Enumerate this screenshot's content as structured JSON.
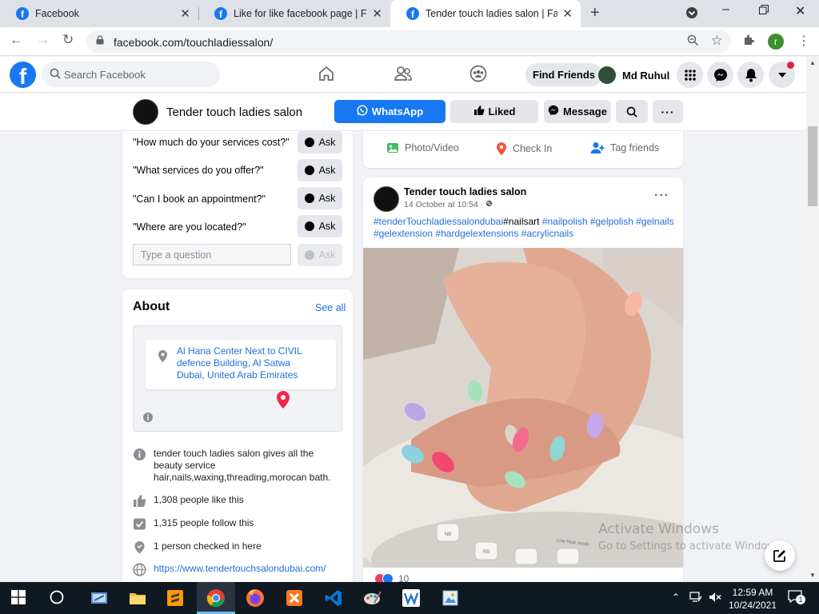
{
  "browser": {
    "tabs": [
      {
        "title": "Facebook",
        "active": false
      },
      {
        "title": "Like for like facebook page | Face",
        "active": false
      },
      {
        "title": "Tender touch ladies salon | Faceb",
        "active": true
      }
    ],
    "tab_close": "✕",
    "new_tab": "+",
    "url": "facebook.com/touchladiessalon/",
    "profile_initial": "r"
  },
  "fb_header": {
    "search_placeholder": "Search Facebook",
    "find_friends": "Find Friends",
    "user_name": "Md Ruhul"
  },
  "page_bar": {
    "page_name": "Tender touch ladies salon",
    "whatsapp": "WhatsApp",
    "liked": "Liked",
    "message": "Message"
  },
  "faq": {
    "questions": [
      "\"How much do your services cost?\"",
      "\"What services do you offer?\"",
      "\"Can I book an appointment?\"",
      "\"Where are you located?\""
    ],
    "ask_label": "Ask",
    "input_placeholder": "Type a question"
  },
  "about": {
    "title": "About",
    "see_all": "See all",
    "address": "Al Hana Center Next to CIVIL defence Building, Al Satwa Dubai, United Arab Emirates",
    "description": "tender touch ladies salon gives all the beauty service hair,nails,waxing,threading,morocan bath.",
    "likes": "1,308 people like this",
    "follows": "1,315 people follow this",
    "checkins": "1 person checked in here",
    "website": "https://www.tendertouchsalondubai.com/"
  },
  "composer_actions": {
    "photo": "Photo/Video",
    "checkin": "Check In",
    "tag": "Tag friends"
  },
  "post": {
    "author": "Tender touch ladies salon",
    "date": "14 October at 10:54 ·",
    "caption_parts": [
      {
        "text": "#tenderTouchladiessalondubai",
        "tag": true
      },
      {
        "text": "#nailsart ",
        "tag": false
      },
      {
        "text": "#nailpolish #gelpolish #gelnails #gelextension #hardgelextensions #acrylicnails",
        "tag": true
      }
    ],
    "reactions_count": "10",
    "image_text": {
      "btn1": "NB",
      "btn2": "RB",
      "mode": "Low heat mode"
    }
  },
  "watermark": {
    "line1": "Activate Windows",
    "line2": "Go to Settings to activate Windows."
  },
  "taskbar": {
    "time": "12:59 AM",
    "date": "10/24/2021",
    "notif_count": "1"
  },
  "colors": {
    "fb_blue": "#1877f2",
    "link": "#216fdb",
    "taskbar": "#101820"
  }
}
